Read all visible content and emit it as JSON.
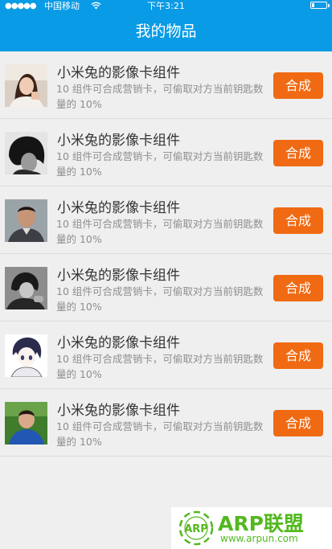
{
  "status_bar": {
    "signal": "●●●●●",
    "carrier": "中国移动",
    "time": "下午3:21",
    "battery_level": 0.15
  },
  "header": {
    "title": "我的物品"
  },
  "items": [
    {
      "title": "小米兔的影像卡组件",
      "description": "10 组件可合成营销卡，可偷取对方当前钥匙数量的 10%",
      "button": "合成"
    },
    {
      "title": "小米兔的影像卡组件",
      "description": "10 组件可合成营销卡，可偷取对方当前钥匙数量的 10%",
      "button": "合成"
    },
    {
      "title": "小米兔的影像卡组件",
      "description": "10 组件可合成营销卡，可偷取对方当前钥匙数量的 10%",
      "button": "合成"
    },
    {
      "title": "小米兔的影像卡组件",
      "description": "10 组件可合成营销卡，可偷取对方当前钥匙数量的 10%",
      "button": "合成"
    },
    {
      "title": "小米兔的影像卡组件",
      "description": "10 组件可合成营销卡，可偷取对方当前钥匙数量的 10%",
      "button": "合成"
    },
    {
      "title": "小米兔的影像卡组件",
      "description": "10 组件可合成营销卡，可偷取对方当前钥匙数量的 10%",
      "button": "合成"
    }
  ],
  "watermark": {
    "logo_text": "ARP",
    "brand": "ARP联盟",
    "url": "www.arpun.com"
  },
  "colors": {
    "accent": "#0a9be6",
    "button": "#f06a13",
    "watermark": "#52b81e"
  }
}
